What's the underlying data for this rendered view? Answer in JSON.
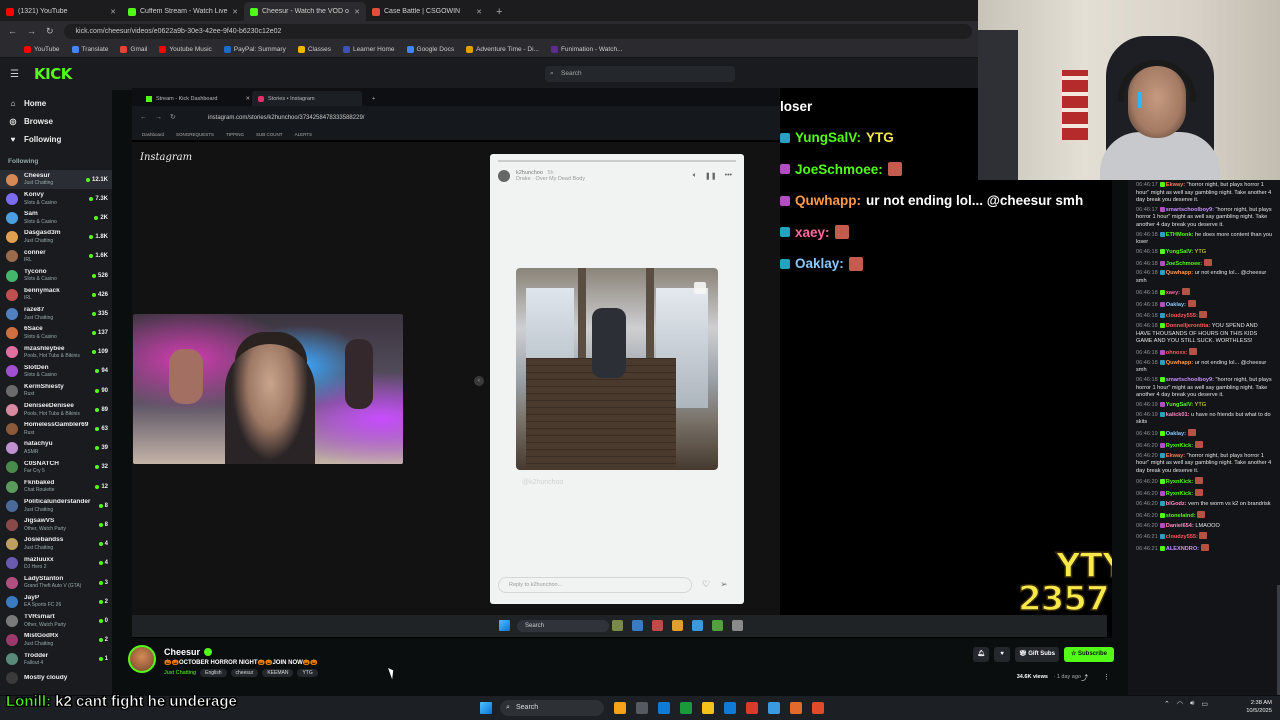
{
  "browser": {
    "tabs": [
      {
        "label": "(1321) YouTube",
        "color": "#ff0000",
        "active": false
      },
      {
        "label": "Cuffem Stream - Watch Live on",
        "color": "#53fc18",
        "active": false
      },
      {
        "label": "Cheesur - Watch the VOD o",
        "color": "#53fc18",
        "active": true
      },
      {
        "label": "Case Battle | CSGOWIN",
        "color": "#e04e3c",
        "active": false
      }
    ],
    "url": "kick.com/cheesur/videos/e0622a9b-30e3-42ee-9f40-b6230c12e02",
    "bookmarks": [
      {
        "label": "YouTube",
        "color": "#ff0000"
      },
      {
        "label": "Translate",
        "color": "#4285f4"
      },
      {
        "label": "Gmail",
        "color": "#ea4335"
      },
      {
        "label": "Youtube Music",
        "color": "#ff0000"
      },
      {
        "label": "PayPal: Summary",
        "color": "#1b6cc7"
      },
      {
        "label": "Classes",
        "color": "#f4b400"
      },
      {
        "label": "Learner Home",
        "color": "#3f51b5"
      },
      {
        "label": "Google Docs",
        "color": "#4285f4"
      },
      {
        "label": "Adventure Time - Di...",
        "color": "#e5a000"
      },
      {
        "label": "Funimation - Watch...",
        "color": "#5b2d8f"
      }
    ]
  },
  "kick": {
    "logo": "KICK",
    "search_placeholder": "Search",
    "nav": [
      {
        "label": "Home",
        "icon": "home-icon"
      },
      {
        "label": "Browse",
        "icon": "compass-icon"
      },
      {
        "label": "Following",
        "icon": "heart-icon"
      }
    ],
    "following_header": "Following",
    "channels": [
      {
        "name": "Cheesur",
        "category": "Just Chatting",
        "viewers": "12.1K",
        "color": "#d58a55",
        "selected": true
      },
      {
        "name": "Konvy",
        "category": "Slots & Casino",
        "viewers": "7.3K",
        "color": "#7b6cf0"
      },
      {
        "name": "Sam",
        "category": "Slots & Casino",
        "viewers": "2K",
        "color": "#4aa0e0"
      },
      {
        "name": "Dasgasd3m",
        "category": "Just Chatting",
        "viewers": "1.8K",
        "color": "#e0a050"
      },
      {
        "name": "conner",
        "category": "IRL",
        "viewers": "1.6K",
        "color": "#9a6b4a"
      },
      {
        "name": "Tycono",
        "category": "Slots & Casino",
        "viewers": "526",
        "color": "#44b86a"
      },
      {
        "name": "bennymack",
        "category": "IRL",
        "viewers": "426",
        "color": "#c05050"
      },
      {
        "name": "raze87",
        "category": "Just Chatting",
        "viewers": "335",
        "color": "#5080c0"
      },
      {
        "name": "6Sace",
        "category": "Slots & Casino",
        "viewers": "137",
        "color": "#d07040"
      },
      {
        "name": "mzashleybee",
        "category": "Pools, Hot Tubs & Bikinis",
        "viewers": "109",
        "color": "#e070a0"
      },
      {
        "name": "SlotDen",
        "category": "Slots & Casino",
        "viewers": "94",
        "color": "#a050d0"
      },
      {
        "name": "KermShiesty",
        "category": "Rust",
        "viewers": "90",
        "color": "#6a6a6a"
      },
      {
        "name": "DeniseeDenisee",
        "category": "Pools, Hot Tubs & Bikinis",
        "viewers": "89",
        "color": "#d88aa0"
      },
      {
        "name": "HomelessGambler69",
        "category": "Rust",
        "viewers": "63",
        "color": "#8a5a3a"
      },
      {
        "name": "natachyu",
        "category": "ASMR",
        "viewers": "39",
        "color": "#c090d0"
      },
      {
        "name": "C0SNATCH",
        "category": "Far Cry 5",
        "viewers": "32",
        "color": "#4a8a4a"
      },
      {
        "name": "Fknbaked",
        "category": "Chat Roulette",
        "viewers": "12",
        "color": "#5a9a5a"
      },
      {
        "name": "Politicalunderstander",
        "category": "Just Chatting",
        "viewers": "8",
        "color": "#4a6a9a"
      },
      {
        "name": "JigsawVS",
        "category": "Other, Watch Party",
        "viewers": "8",
        "color": "#8a4a4a"
      },
      {
        "name": "Josiebandss",
        "category": "Just Chatting",
        "viewers": "4",
        "color": "#c0a060"
      },
      {
        "name": "mazluuxx",
        "category": "DJ Hero 2",
        "viewers": "4",
        "color": "#6a5ab0"
      },
      {
        "name": "LadyStanton",
        "category": "Grand Theft Auto V (GTA)",
        "viewers": "3",
        "color": "#b05080"
      },
      {
        "name": "JayP",
        "category": "EA Sports FC 26",
        "viewers": "2",
        "color": "#3a7ac0"
      },
      {
        "name": "TVRsmart",
        "category": "Other, Watch Party",
        "viewers": "0",
        "color": "#7a7a7a"
      },
      {
        "name": "MistGodRx",
        "category": "Just Chatting",
        "viewers": "2",
        "color": "#9a3a6a"
      },
      {
        "name": "Trodder",
        "category": "Fallout 4",
        "viewers": "1",
        "color": "#5a8a7a"
      },
      {
        "name": "Mostly cloudy",
        "category": "",
        "viewers": "",
        "color": "#3a3a3a"
      }
    ]
  },
  "stream": {
    "inner_tabs": [
      "Stream - Kick Dashboard",
      "Stories • Instagram"
    ],
    "inner_url": "instagram.com/stories/k2hunchoo/3734258478333588229/",
    "inner_bookmarks": [
      "Dashboard",
      "SONGREQUESTS",
      "TIPPING",
      "SUB COUNT",
      "ALERTS"
    ],
    "ig_logo": "Instagram",
    "story_user": "k2hunchoo",
    "story_age": "5h",
    "story_song": "Drake · Over My Dead Body",
    "story_caption": "@k2hunchoo",
    "reply_placeholder": "Reply to k2hunchoo...",
    "taskbar_search": "Search",
    "chat_overlay": [
      {
        "user": "",
        "text": "loser",
        "userColor": "#ffffff",
        "badge": "",
        "emote": false
      },
      {
        "user": "YungSalV:",
        "text": "YTG",
        "userColor": "#53fc18",
        "badge": "#2aa0c0",
        "emote": false
      },
      {
        "user": "JoeSchmoee:",
        "text": "",
        "userColor": "#53fc18",
        "badge": "#b050c0",
        "emote": true
      },
      {
        "user": "Quwhapp:",
        "text": "ur not ending lol... @cheesur smh",
        "userColor": "#ff9a4a",
        "badge": "#b050c0",
        "emote": false
      },
      {
        "user": "xaey:",
        "text": "",
        "userColor": "#ff6aa0",
        "badge": "#2aa0c0",
        "emote": true
      },
      {
        "user": "Oaklay:",
        "text": "",
        "userColor": "#8ac8ff",
        "badge": "#2aa0c0",
        "emote": true
      }
    ],
    "sub_counter": "2357",
    "sub_logo": "YTY"
  },
  "chat": {
    "messages": [
      {
        "ts": "06:46:17",
        "user": "Ekway:",
        "color": "#ff7a5a",
        "text": "\"horror night, but plays horror 1 hour\" might as well say gambling night. Take another 4 day break you deserve it."
      },
      {
        "ts": "06:46:17",
        "user": "smartschoolboy9:",
        "color": "#c890ff",
        "text": "\"horror night, but plays horror 1 hour\" might as well say gambling night. Take another 4 day break you deserve it."
      },
      {
        "ts": "06:46:18",
        "user": "ETHMonk:",
        "color": "#53fc18",
        "text": "he does more content than you loser"
      },
      {
        "ts": "06:46:18",
        "user": "YungSalV:",
        "color": "#53fc18",
        "text": "YTG"
      },
      {
        "ts": "06:46:18",
        "user": "JoeSchmoee:",
        "color": "#53fc18",
        "text": "",
        "emote": true
      },
      {
        "ts": "06:46:18",
        "user": "Quwhapp:",
        "color": "#ff9a4a",
        "text": "ur not ending lol... @cheesur smh"
      },
      {
        "ts": "06:46:18",
        "user": "xaey:",
        "color": "#ff6aa0",
        "text": "",
        "emote": true
      },
      {
        "ts": "06:46:18",
        "user": "Oaklay:",
        "color": "#8ac8ff",
        "text": "",
        "emote": true
      },
      {
        "ts": "06:46:18",
        "user": "cloudzy555:",
        "color": "#ff5a5a",
        "text": "",
        "emote": true
      },
      {
        "ts": "06:46:18",
        "user": "Donnelljerontita:",
        "color": "#ff5a5a",
        "text": "YOU SPEND AND HAVE THOUSANDS OF HOURS ON THIS KIDS GAME AND YOU STILL SUCK. WORTHLESS!"
      },
      {
        "ts": "06:46:18",
        "user": "ohnoxx:",
        "color": "#ff5a5a",
        "text": "",
        "emote": true
      },
      {
        "ts": "06:46:18",
        "user": "Quwhapp:",
        "color": "#ff9a4a",
        "text": "ur not ending lol... @cheesur smh"
      },
      {
        "ts": "06:46:18",
        "user": "smartschoolboy9:",
        "color": "#c890ff",
        "text": "\"horror night, but plays horror 1 hour\" might as well say gambling night. Take another 4 day break you deserve it."
      },
      {
        "ts": "06:46:19",
        "user": "YungSalV:",
        "color": "#53fc18",
        "text": "YTG"
      },
      {
        "ts": "06:46:19",
        "user": "kalick01:",
        "color": "#ff8ac0",
        "text": "u have no friends but what to do skits"
      },
      {
        "ts": "06:46:19",
        "user": "Oaklay:",
        "color": "#8ac8ff",
        "text": "",
        "emote": true
      },
      {
        "ts": "06:46:20",
        "user": "RyxnKick:",
        "color": "#53fc18",
        "text": "",
        "emote": true
      },
      {
        "ts": "06:46:20",
        "user": "Ekway:",
        "color": "#ff7a5a",
        "text": "\"horror night, but plays horror 1 hour\" might as well say gambling night. Take another 4 day break you deserve it."
      },
      {
        "ts": "06:46:20",
        "user": "RyxnKick:",
        "color": "#53fc18",
        "text": "",
        "emote": true
      },
      {
        "ts": "06:46:20",
        "user": "RyxnKick:",
        "color": "#53fc18",
        "text": "",
        "emote": true
      },
      {
        "ts": "06:46:20",
        "user": "blGodz:",
        "color": "#ff8ac0",
        "text": "vern the worm vs k2 on brandrisk"
      },
      {
        "ts": "06:46:20",
        "user": "stonelaind:",
        "color": "#53fc18",
        "text": "",
        "emote": true
      },
      {
        "ts": "06:46:20",
        "user": "Daniel654:",
        "color": "#ff8ac0",
        "text": "LMAOOO"
      },
      {
        "ts": "06:46:21",
        "user": "cloudzy555:",
        "color": "#ff5a5a",
        "text": "",
        "emote": true
      },
      {
        "ts": "06:46:21",
        "user": "ALEXNDRO:",
        "color": "#c890ff",
        "text": "",
        "emote": true
      }
    ]
  },
  "info": {
    "channel": "Cheesur",
    "title": "🎃🎃OCTOBER HORROR NIGHT🎃🎃JOIN NOW🎃🎃",
    "category": "Just Chatting",
    "tags": [
      "English",
      "cheesur",
      "KEEMAN",
      "YTG"
    ],
    "gift_label": "Gift Subs",
    "subscribe_label": "Subscribe",
    "views": "34.6K views",
    "age": "1 day ago"
  },
  "caption": {
    "user": "Lonill:",
    "text": " k2 cant fight he underage"
  },
  "taskbar": {
    "search": "Search",
    "time": "2:38 AM",
    "date": "10/5/2025",
    "apps": [
      "#f7a21b",
      "#555a60",
      "#0f7bd6",
      "#1a9a3a",
      "#f4c21b",
      "#0f7bd6",
      "#d93a2a",
      "#3a9adf",
      "#e26a2a",
      "#e04c2a"
    ]
  }
}
